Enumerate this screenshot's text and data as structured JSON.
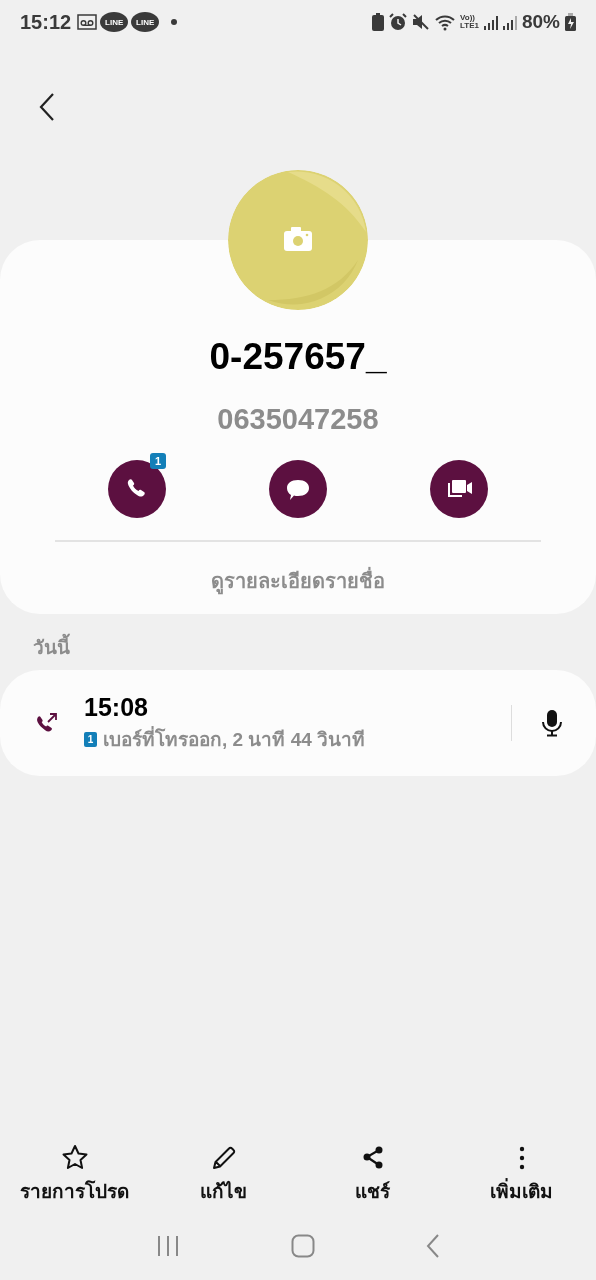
{
  "status_bar": {
    "time": "15:12",
    "notification_labels": [
      "LINE",
      "LINE"
    ],
    "volte": "Vo))",
    "network": "LTE1",
    "battery": "80%"
  },
  "contact": {
    "name": "0-257657_",
    "number": "0635047258",
    "actions": [
      {
        "kind": "call",
        "badge": "1"
      },
      {
        "kind": "message"
      },
      {
        "kind": "video"
      }
    ],
    "details_link": "ดูรายละเอียดรายชื่อ"
  },
  "history": {
    "heading": "วันนี้",
    "calls": [
      {
        "time": "15:08",
        "sim": "1",
        "description": "เบอร์ที่โทรออก, 2 นาที 44 วินาที"
      }
    ]
  },
  "bottom_actions": [
    {
      "kind": "favorite",
      "label": "รายการโปรด"
    },
    {
      "kind": "edit",
      "label": "แก้ไข"
    },
    {
      "kind": "share",
      "label": "แชร์"
    },
    {
      "kind": "more",
      "label": "เพิ่มเติม"
    }
  ]
}
